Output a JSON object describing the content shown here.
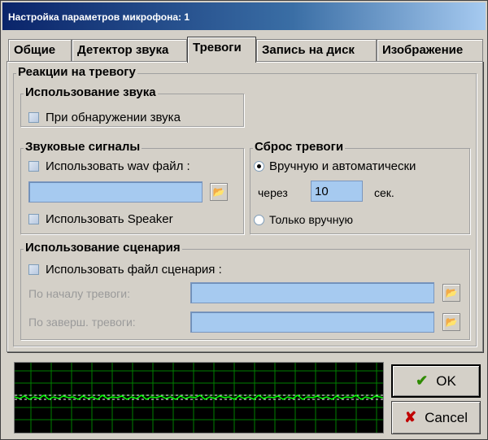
{
  "window": {
    "title": "Настройка параметров микрофона: 1"
  },
  "tabs": [
    {
      "label": "Общие"
    },
    {
      "label": "Детектор звука"
    },
    {
      "label": "Тревоги"
    },
    {
      "label": "Запись на диск"
    },
    {
      "label": "Изображение"
    }
  ],
  "alarm_reactions": {
    "legend": "Реакции на тревогу"
  },
  "sound_usage": {
    "legend": "Использование звука",
    "on_detect_label": "При обнаружении звука"
  },
  "sound_signals": {
    "legend": "Звуковые сигналы",
    "use_wav_label": "Использовать wav файл :",
    "wav_path": "",
    "use_speaker_label": "Использовать Speaker"
  },
  "alarm_reset": {
    "legend": "Сброс тревоги",
    "manual_auto_label": "Вручную и автоматически",
    "after_label": "через",
    "seconds_value": "10",
    "seconds_unit": "сек.",
    "manual_only_label": "Только вручную",
    "selected": "manual_auto"
  },
  "scenario": {
    "legend": "Использование сценария",
    "use_file_label": "Использовать файл сценария :",
    "on_start_label": "По началу тревоги:",
    "on_end_label": "По заверш. тревоги:",
    "on_start_value": "",
    "on_end_value": ""
  },
  "buttons": {
    "ok_label": "OK",
    "cancel_label": "Cancel"
  },
  "colors": {
    "accent": "#a6caf0",
    "title_bar": "#0a246a",
    "waveform": "#00ff00",
    "grid": "#008000",
    "ok_icon": "#2e8b00",
    "cancel_icon": "#c00000"
  }
}
